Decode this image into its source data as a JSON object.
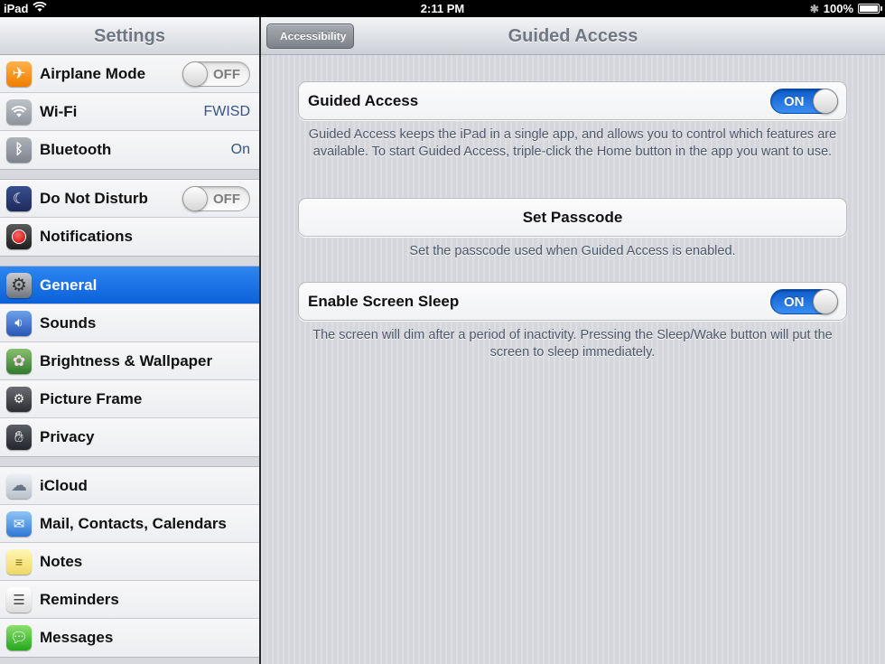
{
  "status_bar": {
    "device": "iPad",
    "time": "2:11 PM",
    "battery": "100%"
  },
  "master": {
    "title": "Settings",
    "groups": [
      [
        {
          "label": "Airplane Mode",
          "icon": "airplane-icon",
          "switch": "OFF"
        },
        {
          "label": "Wi-Fi",
          "icon": "wifi-icon",
          "value": "FWISD"
        },
        {
          "label": "Bluetooth",
          "icon": "bluetooth-icon",
          "value": "On"
        }
      ],
      [
        {
          "label": "Do Not Disturb",
          "icon": "moon-icon",
          "switch": "OFF"
        },
        {
          "label": "Notifications",
          "icon": "notifications-icon"
        }
      ],
      [
        {
          "label": "General",
          "icon": "gear-icon",
          "selected": true
        },
        {
          "label": "Sounds",
          "icon": "speaker-icon"
        },
        {
          "label": "Brightness & Wallpaper",
          "icon": "flower-icon"
        },
        {
          "label": "Picture Frame",
          "icon": "picture-frame-icon"
        },
        {
          "label": "Privacy",
          "icon": "hand-icon"
        }
      ],
      [
        {
          "label": "iCloud",
          "icon": "cloud-icon"
        },
        {
          "label": "Mail, Contacts, Calendars",
          "icon": "mail-icon"
        },
        {
          "label": "Notes",
          "icon": "notes-icon"
        },
        {
          "label": "Reminders",
          "icon": "reminders-icon"
        },
        {
          "label": "Messages",
          "icon": "messages-icon"
        }
      ]
    ]
  },
  "detail": {
    "back_label": "Accessibility",
    "title": "Guided Access",
    "guided_access": {
      "label": "Guided Access",
      "switch": "ON",
      "footnote": "Guided Access keeps the iPad in a single app, and allows you to control which features are available. To start Guided Access, triple-click the Home button in the app you want to use."
    },
    "passcode": {
      "label": "Set Passcode",
      "footnote": "Set the passcode used when Guided Access is enabled."
    },
    "screen_sleep": {
      "label": "Enable Screen Sleep",
      "switch": "ON",
      "footnote": "The screen will dim after a period of inactivity. Pressing the Sleep/Wake button will put the screen to sleep immediately."
    }
  },
  "colors": {
    "selection": "#1a73e8",
    "switch_on": "#2a7ae2",
    "detail_value": "#385487"
  }
}
